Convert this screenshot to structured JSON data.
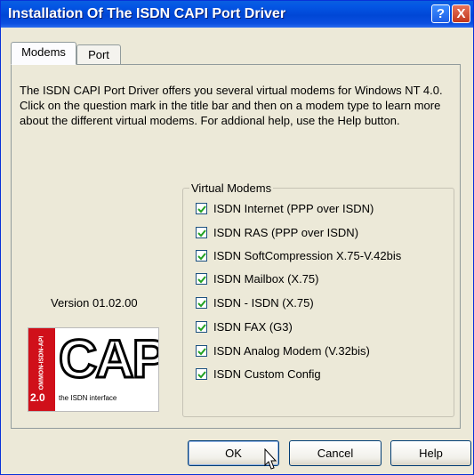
{
  "window": {
    "title": "Installation Of The ISDN CAPI Port Driver",
    "help_button": "?",
    "close_button": "X"
  },
  "tabs": [
    {
      "label": "Modems",
      "active": true
    },
    {
      "label": "Port",
      "active": false
    }
  ],
  "description": {
    "line1": "The ISDN CAPI Port Driver offers you several virtual modems for Windows NT 4.0.",
    "line2": "Click on the question mark in the title bar and then on a modem type to learn more about the different virtual modems. For addional help, use the Help button."
  },
  "version_text": "Version 01.02.00",
  "logo": {
    "side_text": "COMMON-ISDN-API",
    "main_text": "CAPI",
    "version": "2.0",
    "tagline": "the ISDN interface"
  },
  "virtual_modems": {
    "title": "Virtual Modems",
    "items": [
      {
        "label": "ISDN Internet (PPP over ISDN)",
        "checked": true
      },
      {
        "label": "ISDN RAS (PPP over ISDN)",
        "checked": true
      },
      {
        "label": "ISDN SoftCompression X.75-V.42bis",
        "checked": true
      },
      {
        "label": "ISDN Mailbox (X.75)",
        "checked": true
      },
      {
        "label": "ISDN - ISDN (X.75)",
        "checked": true
      },
      {
        "label": "ISDN FAX (G3)",
        "checked": true
      },
      {
        "label": "ISDN Analog Modem (V.32bis)",
        "checked": true
      },
      {
        "label": "ISDN Custom Config",
        "checked": true
      }
    ]
  },
  "buttons": {
    "ok": "OK",
    "cancel": "Cancel",
    "help": "Help"
  },
  "colors": {
    "titlebar": "#0047d6",
    "logo_red": "#d0101a",
    "dialog_bg": "#ece9d8"
  }
}
